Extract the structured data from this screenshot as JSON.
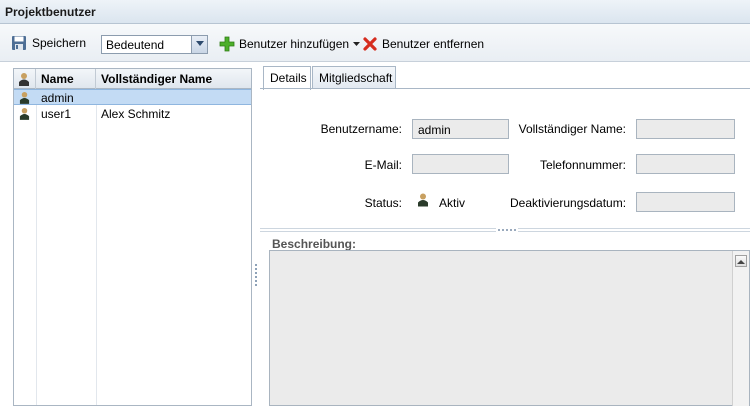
{
  "title": "Projektbenutzer",
  "toolbar": {
    "save_label": "Speichern",
    "filter_value": "Bedeutend",
    "add_label": "Benutzer hinzufügen",
    "remove_label": "Benutzer entfernen"
  },
  "user_list": {
    "columns": [
      "Name",
      "Vollständiger Name"
    ],
    "rows": [
      {
        "name": "admin",
        "full_name": "",
        "selected": true
      },
      {
        "name": "user1",
        "full_name": "Alex Schmitz",
        "selected": false
      }
    ]
  },
  "tabs": [
    {
      "label": "Details",
      "active": true
    },
    {
      "label": "Mitgliedschaft",
      "active": false
    }
  ],
  "details": {
    "username_label": "Benutzername:",
    "username_value": "admin",
    "fullname_label": "Vollständiger Name:",
    "fullname_value": "",
    "email_label": "E-Mail:",
    "email_value": "",
    "phone_label": "Telefonnummer:",
    "phone_value": "",
    "status_label": "Status:",
    "status_value": "Aktiv",
    "deactivation_label": "Deaktivierungsdatum:",
    "deactivation_value": "",
    "description_label": "Beschreibung:"
  },
  "icons": {
    "save": "save-icon",
    "add": "add-user-icon",
    "remove": "remove-user-icon",
    "user": "user-icon"
  },
  "colors": {
    "selection": "#c3dbf4",
    "add_green": "#4caf2a",
    "remove_red": "#d62d1f"
  }
}
